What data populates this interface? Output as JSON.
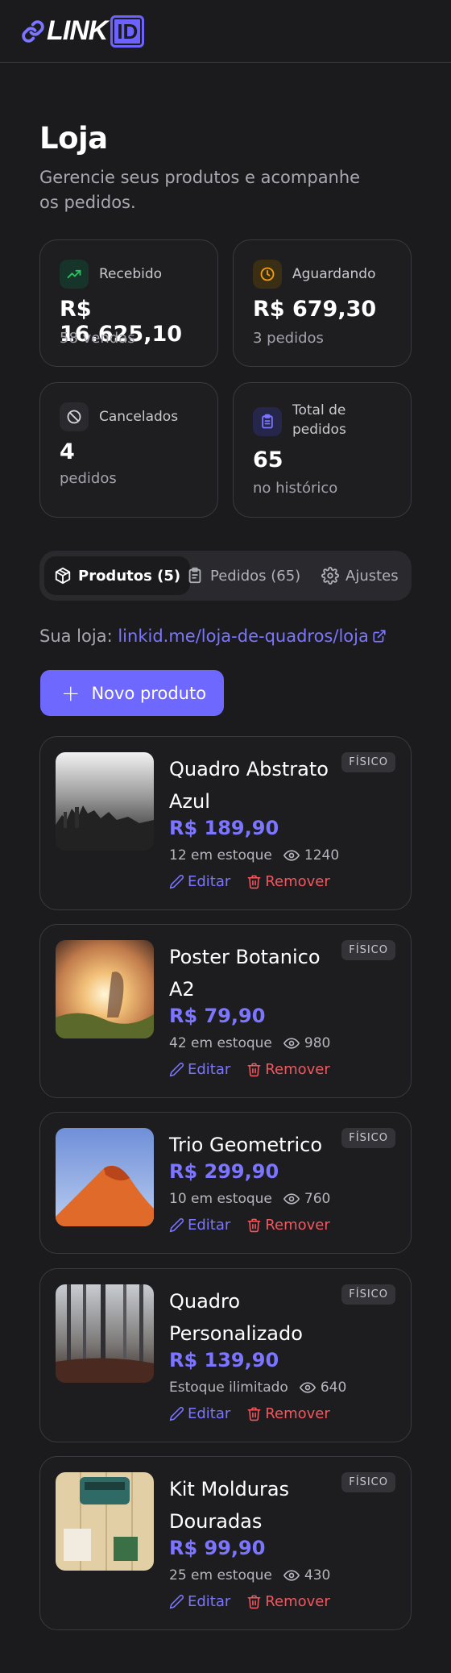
{
  "brand": {
    "logo_text": "LINK",
    "logo_badge": "ID"
  },
  "page": {
    "title": "Loja",
    "subtitle": "Gerencie seus produtos e acompanhe os pedidos."
  },
  "stats": [
    {
      "label": "Recebido",
      "value": "R$ 16.625,10",
      "note": "58 vendas",
      "icon": "trending-up-icon",
      "color": "#22c55e"
    },
    {
      "label": "Aguardando",
      "value": "R$ 679,30",
      "note": "3 pedidos",
      "icon": "clock-icon",
      "color": "#f59e0b"
    },
    {
      "label": "Cancelados",
      "value": "4",
      "note": "pedidos",
      "icon": "ban-icon",
      "color": "#d4d4d8"
    },
    {
      "label": "Total de pedidos",
      "value": "65",
      "note": "no histórico",
      "icon": "clipboard-list-icon",
      "color": "#7b75ff"
    }
  ],
  "tabs": [
    {
      "label": "Produtos (5)",
      "active": true
    },
    {
      "label": "Pedidos (65)",
      "active": false
    },
    {
      "label": "Ajustes",
      "active": false
    }
  ],
  "store": {
    "prefix": "Sua loja:",
    "url": "linkid.me/loja-de-quadros/loja"
  },
  "new_product_label": "Novo produto",
  "products": [
    {
      "name": "Quadro Abstrato Azul",
      "badge": "FÍSICO",
      "price": "R$ 189,90",
      "stock": "12 em estoque",
      "views": "1240",
      "edit": "Editar",
      "remove": "Remover"
    },
    {
      "name": "Poster Botanico A2",
      "badge": "FÍSICO",
      "price": "R$ 79,90",
      "stock": "42 em estoque",
      "views": "980",
      "edit": "Editar",
      "remove": "Remover"
    },
    {
      "name": "Trio Geometrico",
      "badge": "FÍSICO",
      "price": "R$ 299,90",
      "stock": "10 em estoque",
      "views": "760",
      "edit": "Editar",
      "remove": "Remover"
    },
    {
      "name": "Quadro Personalizado",
      "badge": "FÍSICO",
      "price": "R$ 139,90",
      "stock": "Estoque ilimitado",
      "views": "640",
      "edit": "Editar",
      "remove": "Remover"
    },
    {
      "name": "Kit Molduras Douradas",
      "badge": "FÍSICO",
      "price": "R$ 99,90",
      "stock": "25 em estoque",
      "views": "430",
      "edit": "Editar",
      "remove": "Remover"
    }
  ],
  "colors": {
    "accent": "#6f68ff",
    "danger": "#f0585f",
    "background": "#1b1b1e"
  }
}
